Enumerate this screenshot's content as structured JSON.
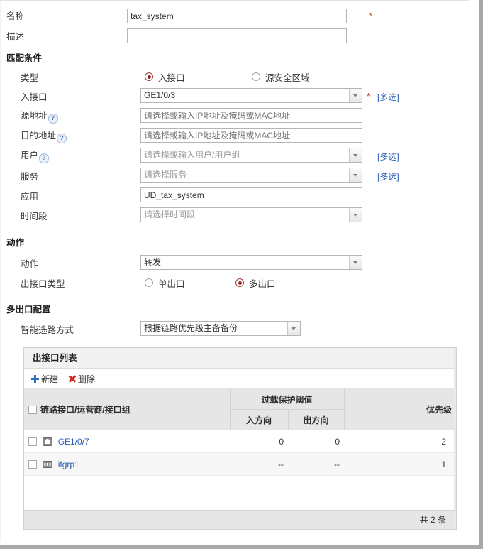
{
  "form": {
    "name": {
      "label": "名称",
      "value": "tax_system",
      "required_mark": "*"
    },
    "description": {
      "label": "描述",
      "value": "",
      "placeholder": ""
    }
  },
  "match_section": {
    "title": "匹配条件",
    "type": {
      "label": "类型",
      "options": [
        {
          "label": "入接口",
          "selected": true
        },
        {
          "label": "源安全区域",
          "selected": false
        }
      ]
    },
    "in_interface": {
      "label": "入接口",
      "value": "GE1/0/3",
      "required_mark": "*",
      "multi_link": "[多选]"
    },
    "source_address": {
      "label": "源地址",
      "help": "?",
      "placeholder": "请选择或输入IP地址及掩码或MAC地址",
      "value": ""
    },
    "dest_address": {
      "label": "目的地址",
      "help": "?",
      "placeholder": "请选择或输入IP地址及掩码或MAC地址",
      "value": ""
    },
    "user": {
      "label": "用户",
      "help": "?",
      "placeholder": "请选择或输入用户/用户组",
      "value": "",
      "multi_link": "[多选]"
    },
    "service": {
      "label": "服务",
      "placeholder": "请选择服务",
      "value": "",
      "multi_link": "[多选]"
    },
    "application": {
      "label": "应用",
      "value": "UD_tax_system"
    },
    "time_range": {
      "label": "时间段",
      "placeholder": "请选择时间段",
      "value": ""
    }
  },
  "action_section": {
    "title": "动作",
    "action": {
      "label": "动作",
      "value": "转发"
    },
    "out_interface_type": {
      "label": "出接口类型",
      "options": [
        {
          "label": "单出口",
          "selected": false
        },
        {
          "label": "多出口",
          "selected": true
        }
      ]
    }
  },
  "multi_exit_section": {
    "title": "多出口配置",
    "smart_route": {
      "label": "智能选路方式",
      "value": "根据链路优先级主备备份"
    },
    "panel": {
      "title": "出接口列表",
      "toolbar": {
        "new_label": "新建",
        "delete_label": "删除"
      },
      "columns": {
        "interface": "链路接口/运营商/接口组",
        "overload_group": "过载保护阈值",
        "inbound": "入方向",
        "outbound": "出方向",
        "priority": "优先级"
      },
      "rows": [
        {
          "checked": false,
          "icon": "interface-icon",
          "name": "GE1/0/7",
          "inbound": "0",
          "outbound": "0",
          "priority": "2"
        },
        {
          "checked": false,
          "icon": "interface-group-icon",
          "name": "ifgrp1",
          "inbound": "--",
          "outbound": "--",
          "priority": "1"
        }
      ],
      "footer": "共 2 条"
    }
  },
  "colors": {
    "link": "#2a5db0",
    "required": "#d73a2e",
    "radio_selected": "#9d1f1f",
    "new_icon": "#2e6fc4",
    "delete_icon": "#cf2a20"
  }
}
